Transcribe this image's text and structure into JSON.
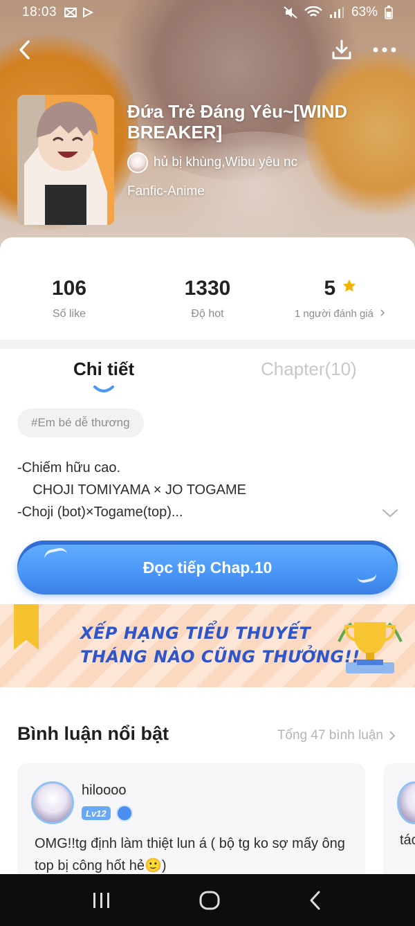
{
  "status_bar": {
    "time": "18:03",
    "battery": "63%"
  },
  "story": {
    "title": "Đứa Trẻ Đáng Yêu~[WIND BREAKER]",
    "author": "hủ bị khùng,Wibu yêu nc",
    "genre": "Fanfic-Anime"
  },
  "stats": [
    {
      "value": "106",
      "label": "Số like"
    },
    {
      "value": "1330",
      "label": "Độ hot"
    },
    {
      "value": "5",
      "label": "1 người đánh giá"
    }
  ],
  "tabs": {
    "detail": "Chi tiết",
    "chapters": "Chapter(10)"
  },
  "tag": "#Em bé dễ thương",
  "description": [
    "-Chiếm hữu cao.",
    "    CHOJI TOMIYAMA × JO TOGAME",
    "-Choji (bot)×Togame(top)..."
  ],
  "read_button": "Đọc tiếp Chap.10",
  "banner": {
    "line1": "XẾP HẠNG TIỂU THUYẾT",
    "line2": "THÁNG NÀO CŨNG THƯỞNG!!"
  },
  "comments": {
    "title": "Bình luận nổi bật",
    "total": "Tổng 47 bình luận",
    "items": [
      {
        "user": "hiloooo",
        "level": "Lv12",
        "text": "OMG!!tg định làm thiệt lun á ( bộ tg ko sợ mấy ông top bị công hốt hẻ🙂)"
      },
      {
        "text": "tác"
      }
    ]
  },
  "colors": {
    "accent": "#4a96f7",
    "star": "#f5b400",
    "banner_text": "#2f55c9"
  }
}
